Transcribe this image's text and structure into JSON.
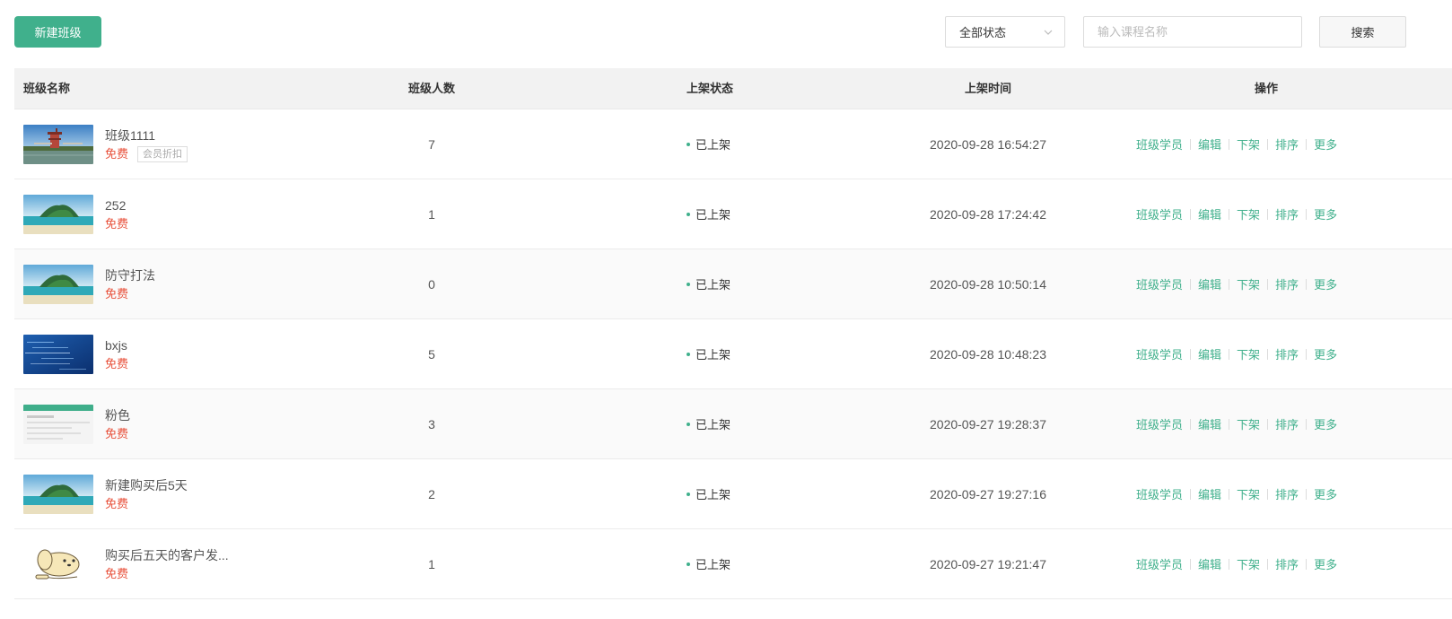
{
  "toolbar": {
    "new_button": "新建班级",
    "status_select": "全部状态",
    "search_placeholder": "输入课程名称",
    "search_button": "搜索"
  },
  "table": {
    "columns": [
      "班级名称",
      "班级人数",
      "上架状态",
      "上架时间",
      "操作"
    ],
    "operations": [
      "班级学员",
      "编辑",
      "下架",
      "排序",
      "更多"
    ],
    "rows": [
      {
        "title": "班级1111",
        "price": "免费",
        "tag": "会员折扣",
        "count": "7",
        "status": "已上架",
        "time": "2020-09-28 16:54:27",
        "thumb": "pagoda-lake"
      },
      {
        "title": "252",
        "price": "免费",
        "tag": "",
        "count": "1",
        "status": "已上架",
        "time": "2020-09-28 17:24:42",
        "thumb": "tropical-island"
      },
      {
        "title": "防守打法",
        "price": "免费",
        "tag": "",
        "count": "0",
        "status": "已上架",
        "time": "2020-09-28 10:50:14",
        "thumb": "tropical-island"
      },
      {
        "title": "bxjs",
        "price": "免费",
        "tag": "",
        "count": "5",
        "status": "已上架",
        "time": "2020-09-28 10:48:23",
        "thumb": "blue-code"
      },
      {
        "title": "粉色",
        "price": "免费",
        "tag": "",
        "count": "3",
        "status": "已上架",
        "time": "2020-09-27 19:28:37",
        "thumb": "webpage-screenshot"
      },
      {
        "title": "新建购买后5天",
        "price": "免费",
        "tag": "",
        "count": "2",
        "status": "已上架",
        "time": "2020-09-27 19:27:16",
        "thumb": "tropical-island"
      },
      {
        "title": "购买后五天的客户发...",
        "price": "免费",
        "tag": "",
        "count": "1",
        "status": "已上架",
        "time": "2020-09-27 19:21:47",
        "thumb": "cartoon-dog"
      }
    ]
  },
  "colors": {
    "accent": "#40b08c",
    "price": "#e8503a"
  }
}
